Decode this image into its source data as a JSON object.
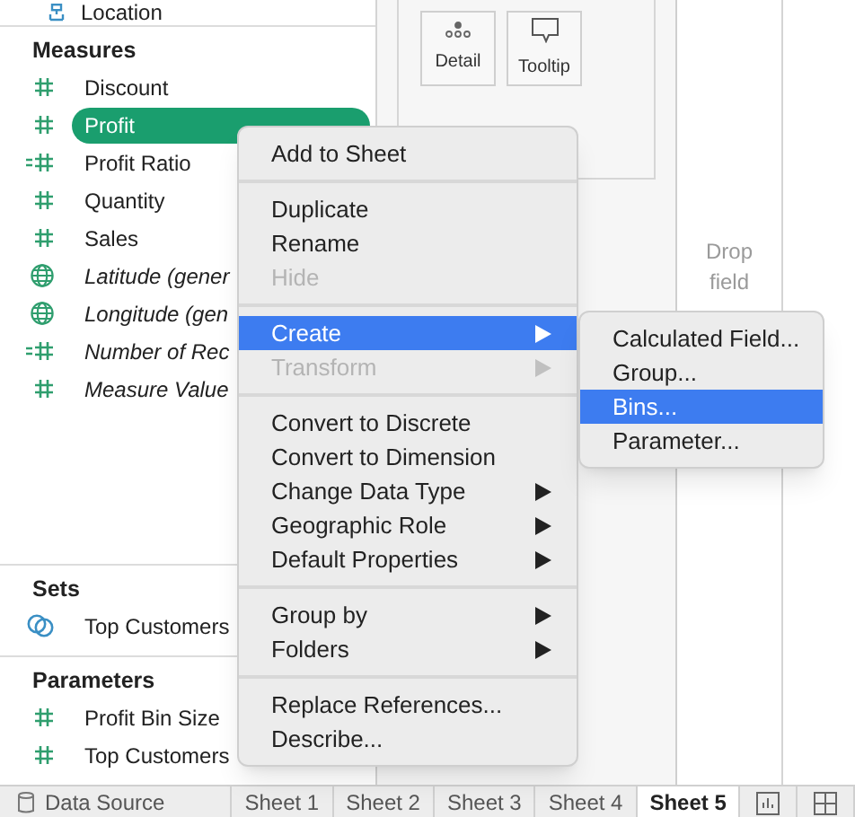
{
  "data_pane": {
    "top_item": {
      "label": "Location",
      "kind": "hierarchy"
    },
    "sections": [
      {
        "title": "Measures",
        "items": [
          {
            "label": "Discount",
            "kind": "number",
            "italic": false,
            "selected": false
          },
          {
            "label": "Profit",
            "kind": "number",
            "italic": false,
            "selected": true
          },
          {
            "label": "Profit Ratio",
            "kind": "calc",
            "italic": false,
            "selected": false
          },
          {
            "label": "Quantity",
            "kind": "number",
            "italic": false,
            "selected": false
          },
          {
            "label": "Sales",
            "kind": "number",
            "italic": false,
            "selected": false
          },
          {
            "label": "Latitude (gener",
            "kind": "globe",
            "italic": true,
            "selected": false
          },
          {
            "label": "Longitude (gen",
            "kind": "globe",
            "italic": true,
            "selected": false
          },
          {
            "label": "Number of Rec",
            "kind": "calc",
            "italic": true,
            "selected": false
          },
          {
            "label": "Measure Value",
            "kind": "number",
            "italic": true,
            "selected": false
          }
        ]
      },
      {
        "title": "Sets",
        "items": [
          {
            "label": "Top Customers",
            "kind": "set",
            "italic": false,
            "selected": false
          }
        ]
      },
      {
        "title": "Parameters",
        "items": [
          {
            "label": "Profit Bin Size",
            "kind": "number",
            "italic": false,
            "selected": false
          },
          {
            "label": "Top Customers",
            "kind": "number",
            "italic": false,
            "selected": false
          }
        ]
      }
    ]
  },
  "marks_card": {
    "buttons": [
      {
        "label": "Detail",
        "kind": "dots"
      },
      {
        "label": "Tooltip",
        "kind": "speech"
      }
    ]
  },
  "view": {
    "drop_hint": "Drop field"
  },
  "context_menu": {
    "groups": [
      [
        {
          "label": "Add to Sheet",
          "disabled": false,
          "highlighted": false,
          "submenu": false
        }
      ],
      [
        {
          "label": "Duplicate",
          "disabled": false,
          "highlighted": false,
          "submenu": false
        },
        {
          "label": "Rename",
          "disabled": false,
          "highlighted": false,
          "submenu": false
        },
        {
          "label": "Hide",
          "disabled": true,
          "highlighted": false,
          "submenu": false
        }
      ],
      [
        {
          "label": "Create",
          "disabled": false,
          "highlighted": true,
          "submenu": true
        },
        {
          "label": "Transform",
          "disabled": true,
          "highlighted": false,
          "submenu": true
        }
      ],
      [
        {
          "label": "Convert to Discrete",
          "disabled": false,
          "highlighted": false,
          "submenu": false
        },
        {
          "label": "Convert to Dimension",
          "disabled": false,
          "highlighted": false,
          "submenu": false
        },
        {
          "label": "Change Data Type",
          "disabled": false,
          "highlighted": false,
          "submenu": true
        },
        {
          "label": "Geographic Role",
          "disabled": false,
          "highlighted": false,
          "submenu": true
        },
        {
          "label": "Default Properties",
          "disabled": false,
          "highlighted": false,
          "submenu": true
        }
      ],
      [
        {
          "label": "Group by",
          "disabled": false,
          "highlighted": false,
          "submenu": true
        },
        {
          "label": "Folders",
          "disabled": false,
          "highlighted": false,
          "submenu": true
        }
      ],
      [
        {
          "label": "Replace References...",
          "disabled": false,
          "highlighted": false,
          "submenu": false
        },
        {
          "label": "Describe...",
          "disabled": false,
          "highlighted": false,
          "submenu": false
        }
      ]
    ]
  },
  "submenu": {
    "items": [
      {
        "label": "Calculated Field...",
        "highlighted": false
      },
      {
        "label": "Group...",
        "highlighted": false
      },
      {
        "label": "Bins...",
        "highlighted": true
      },
      {
        "label": "Parameter...",
        "highlighted": false
      }
    ]
  },
  "sheet_tabs": [
    {
      "label": "Data Source",
      "kind": "source",
      "selected": false
    },
    {
      "label": "Sheet 1",
      "kind": "sheet",
      "selected": false
    },
    {
      "label": "Sheet 2",
      "kind": "sheet",
      "selected": false
    },
    {
      "label": "Sheet 3",
      "kind": "sheet",
      "selected": false
    },
    {
      "label": "Sheet 4",
      "kind": "sheet",
      "selected": false
    },
    {
      "label": "Sheet 5",
      "kind": "sheet",
      "selected": true
    },
    {
      "kind": "new-sheet"
    },
    {
      "kind": "new-dashboard"
    }
  ]
}
